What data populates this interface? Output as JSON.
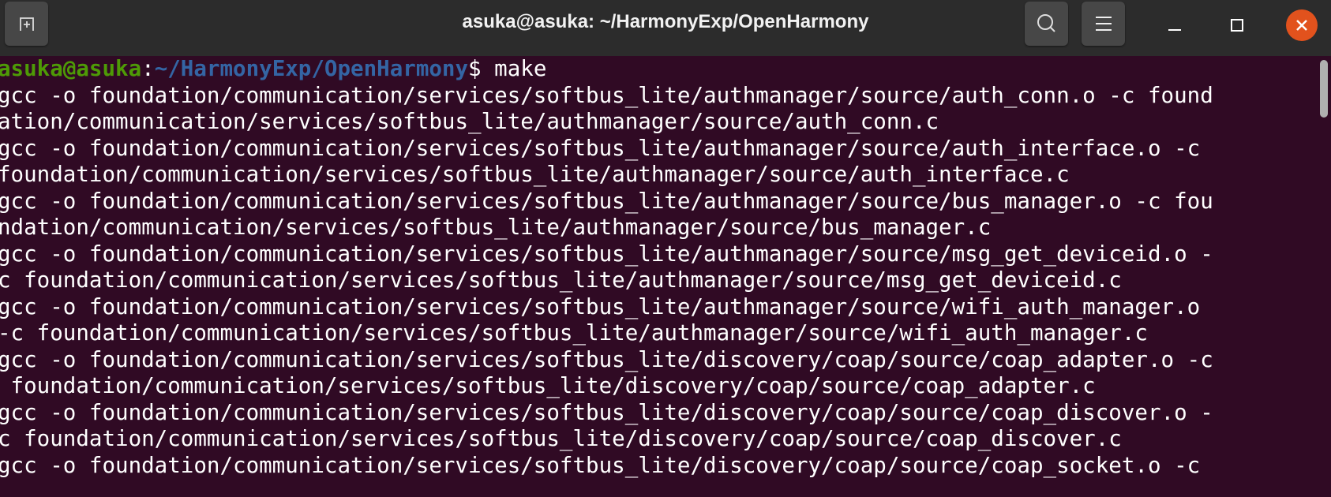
{
  "window": {
    "title": "asuka@asuka: ~/HarmonyExp/OpenHarmony",
    "icons": {
      "new_tab": "new-tab-icon",
      "search": "search-icon",
      "menu": "hamburger-menu-icon",
      "minimize": "minimize-icon",
      "maximize": "maximize-icon",
      "close": "close-icon"
    },
    "close_color": "#e2521d"
  },
  "terminal": {
    "background": "#300a24",
    "prompt": {
      "user_host": "asuka@asuka",
      "sep": ":",
      "path": "~/HarmonyExp/OpenHarmony",
      "symbol": "$",
      "command": " make"
    },
    "lines": [
      "gcc -o foundation/communication/services/softbus_lite/authmanager/source/auth_conn.o -c found",
      "ation/communication/services/softbus_lite/authmanager/source/auth_conn.c",
      "gcc -o foundation/communication/services/softbus_lite/authmanager/source/auth_interface.o -c",
      "foundation/communication/services/softbus_lite/authmanager/source/auth_interface.c",
      "gcc -o foundation/communication/services/softbus_lite/authmanager/source/bus_manager.o -c fou",
      "ndation/communication/services/softbus_lite/authmanager/source/bus_manager.c",
      "gcc -o foundation/communication/services/softbus_lite/authmanager/source/msg_get_deviceid.o -",
      "c foundation/communication/services/softbus_lite/authmanager/source/msg_get_deviceid.c",
      "gcc -o foundation/communication/services/softbus_lite/authmanager/source/wifi_auth_manager.o",
      "-c foundation/communication/services/softbus_lite/authmanager/source/wifi_auth_manager.c",
      "gcc -o foundation/communication/services/softbus_lite/discovery/coap/source/coap_adapter.o -c",
      " foundation/communication/services/softbus_lite/discovery/coap/source/coap_adapter.c",
      "gcc -o foundation/communication/services/softbus_lite/discovery/coap/source/coap_discover.o -",
      "c foundation/communication/services/softbus_lite/discovery/coap/source/coap_discover.c",
      "gcc -o foundation/communication/services/softbus_lite/discovery/coap/source/coap_socket.o -c"
    ]
  }
}
